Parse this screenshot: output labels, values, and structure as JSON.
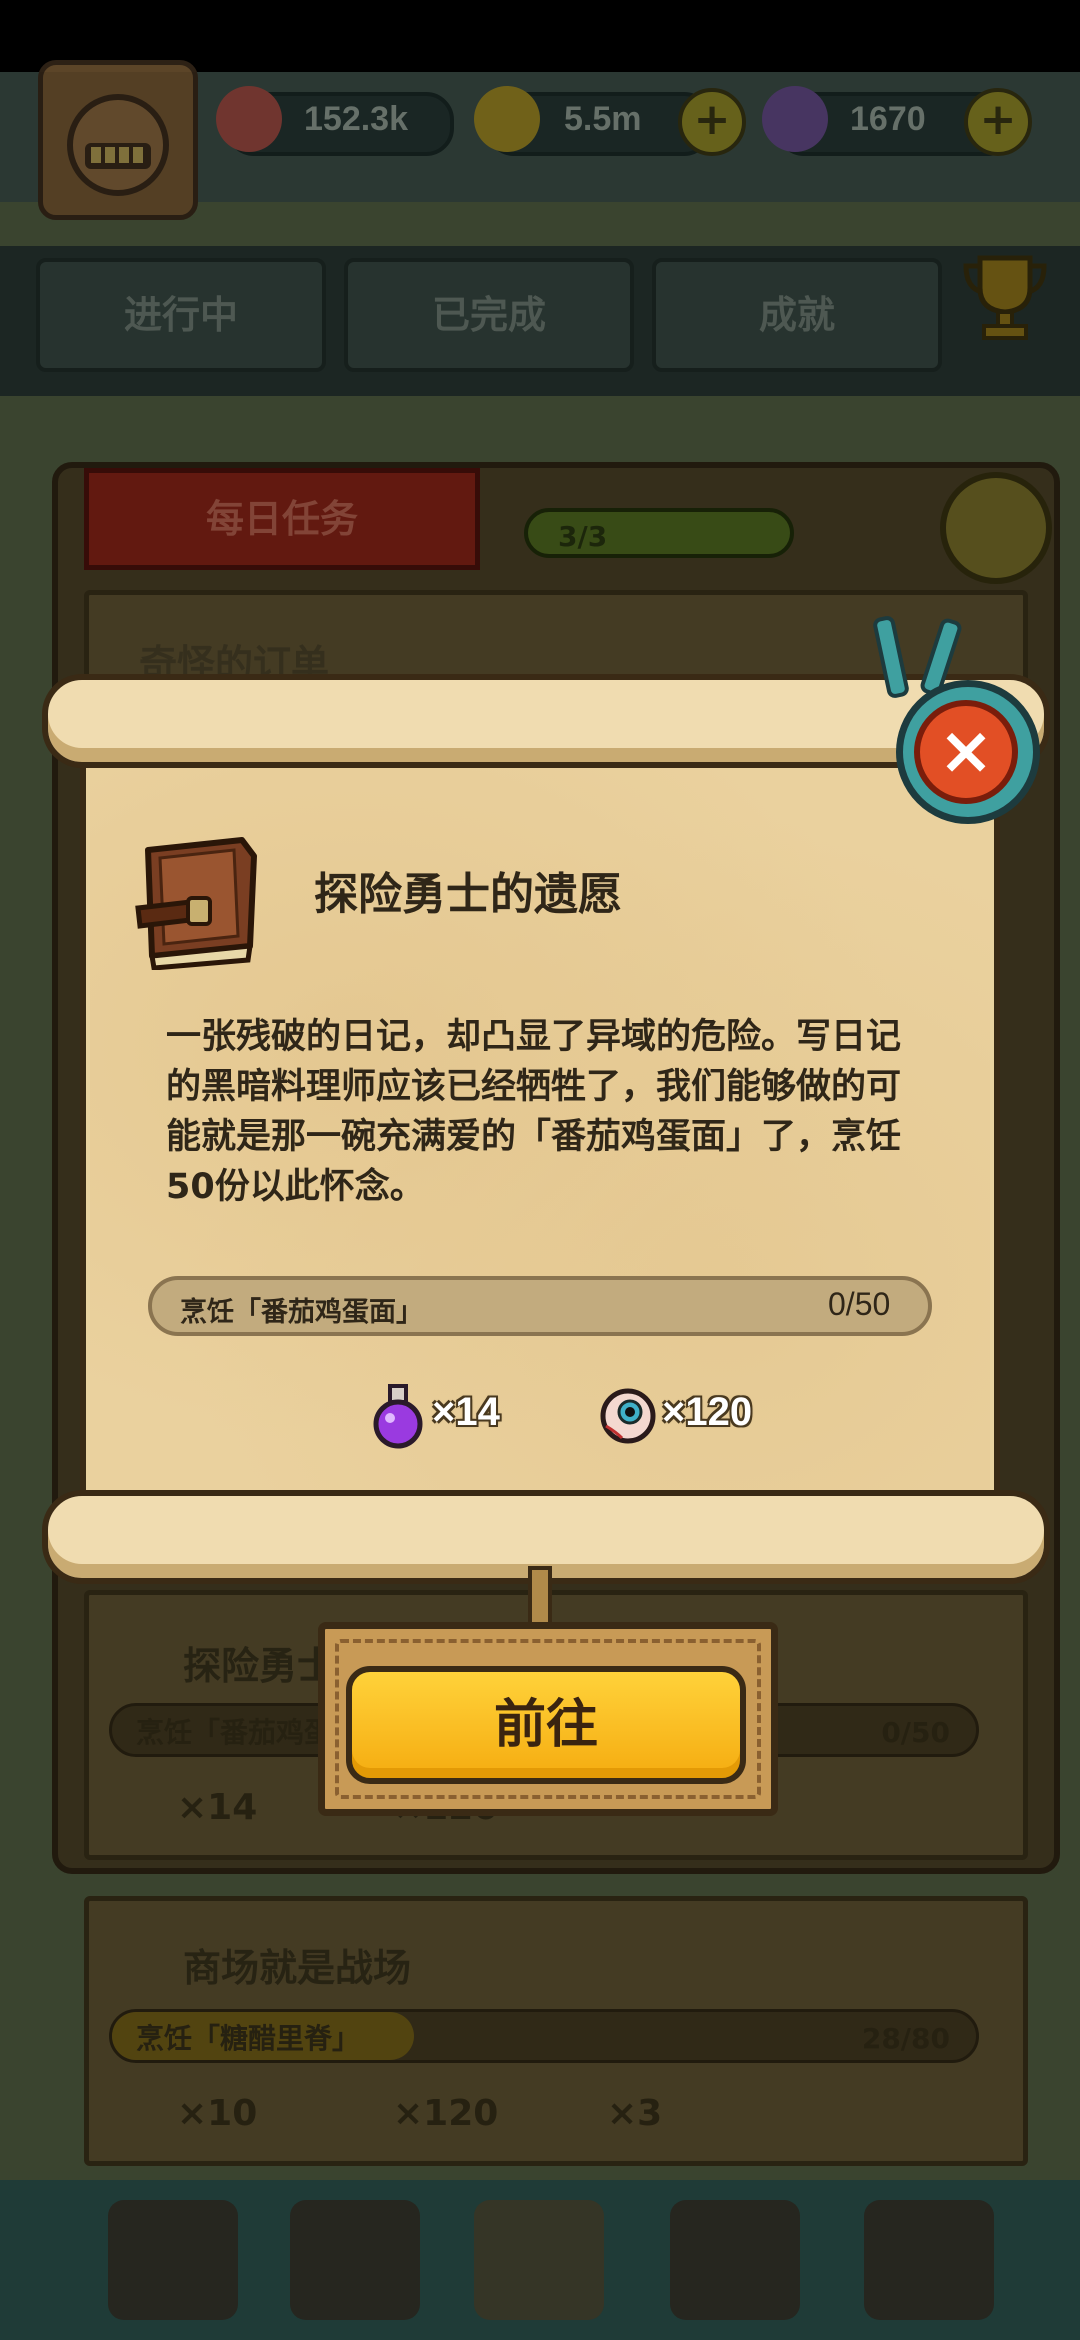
{
  "top_bar": {
    "eyeballs": "152.3k",
    "coins": "5.5m",
    "potions": "1670",
    "plus_label": "+"
  },
  "tabs": [
    {
      "label": "进行中"
    },
    {
      "label": "已完成"
    },
    {
      "label": "成就"
    }
  ],
  "daily": {
    "header": "每日任务",
    "progress": "3/3",
    "first_quest_title": "奇怪的订单"
  },
  "cards": [
    {
      "title": "探险勇士",
      "bar_label": "烹饪「番茄鸡蛋",
      "progress": "0/50",
      "rewards": [
        "×14",
        "×120"
      ]
    },
    {
      "title": "商场就是战场",
      "bar_label": "烹饪「糖醋里脊」",
      "progress": "28/80",
      "progress_fraction": 0.35,
      "rewards": [
        "×10",
        "×120",
        "×3"
      ]
    }
  ],
  "dialog": {
    "title": "探险勇士的遗愿",
    "description": "一张残破的日记，却凸显了异域的危险。写日记的黑暗料理师应该已经牺牲了，我们能够做的可能就是那一碗充满爱的「番茄鸡蛋面」了，烹饪50份以此怀念。",
    "progress_label": "烹饪「番茄鸡蛋面」",
    "progress_value": "0/50",
    "progress_fraction": 0,
    "reward_potion": "×14",
    "reward_eyeball": "×120",
    "close_label": "×",
    "go_button": "前往"
  },
  "icons": [
    "eyeball-icon",
    "coin-icon",
    "potion-icon",
    "trophy-icon",
    "refresh-icon",
    "book-icon",
    "close-icon"
  ],
  "colors": {
    "go_button": "#f5ac10",
    "close_button": "#e24f25",
    "scroll": "#ead19e"
  }
}
